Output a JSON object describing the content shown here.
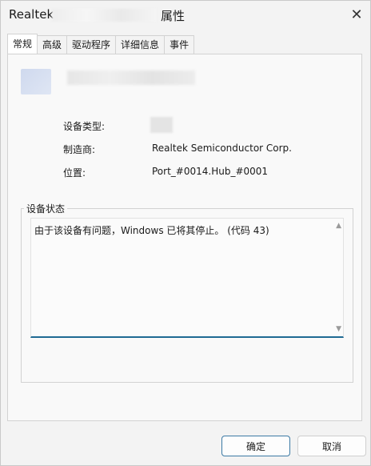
{
  "window": {
    "title_prefix": "Realtek",
    "title_suffix": "属性",
    "close_glyph": "✕"
  },
  "tabs": [
    {
      "label": "常规",
      "active": true
    },
    {
      "label": "高级",
      "active": false
    },
    {
      "label": "驱动程序",
      "active": false
    },
    {
      "label": "详细信息",
      "active": false
    },
    {
      "label": "事件",
      "active": false
    }
  ],
  "properties": {
    "device_type_label": "设备类型:",
    "manufacturer_label": "制造商:",
    "manufacturer_value": "Realtek Semiconductor Corp.",
    "location_label": "位置:",
    "location_value": "Port_#0014.Hub_#0001"
  },
  "device_status": {
    "title": "设备状态",
    "text": "由于该设备有问题，Windows 已将其停止。 (代码 43)"
  },
  "buttons": {
    "ok_label": "确定",
    "cancel_label": "取消"
  },
  "colors": {
    "accent": "#1f6a93",
    "window_bg": "#f3f3f3",
    "panel_bg": "#f9f9f9"
  },
  "icons": {
    "close": "close-icon",
    "scroll_up": "scroll-up-icon",
    "scroll_down": "scroll-down-icon"
  }
}
